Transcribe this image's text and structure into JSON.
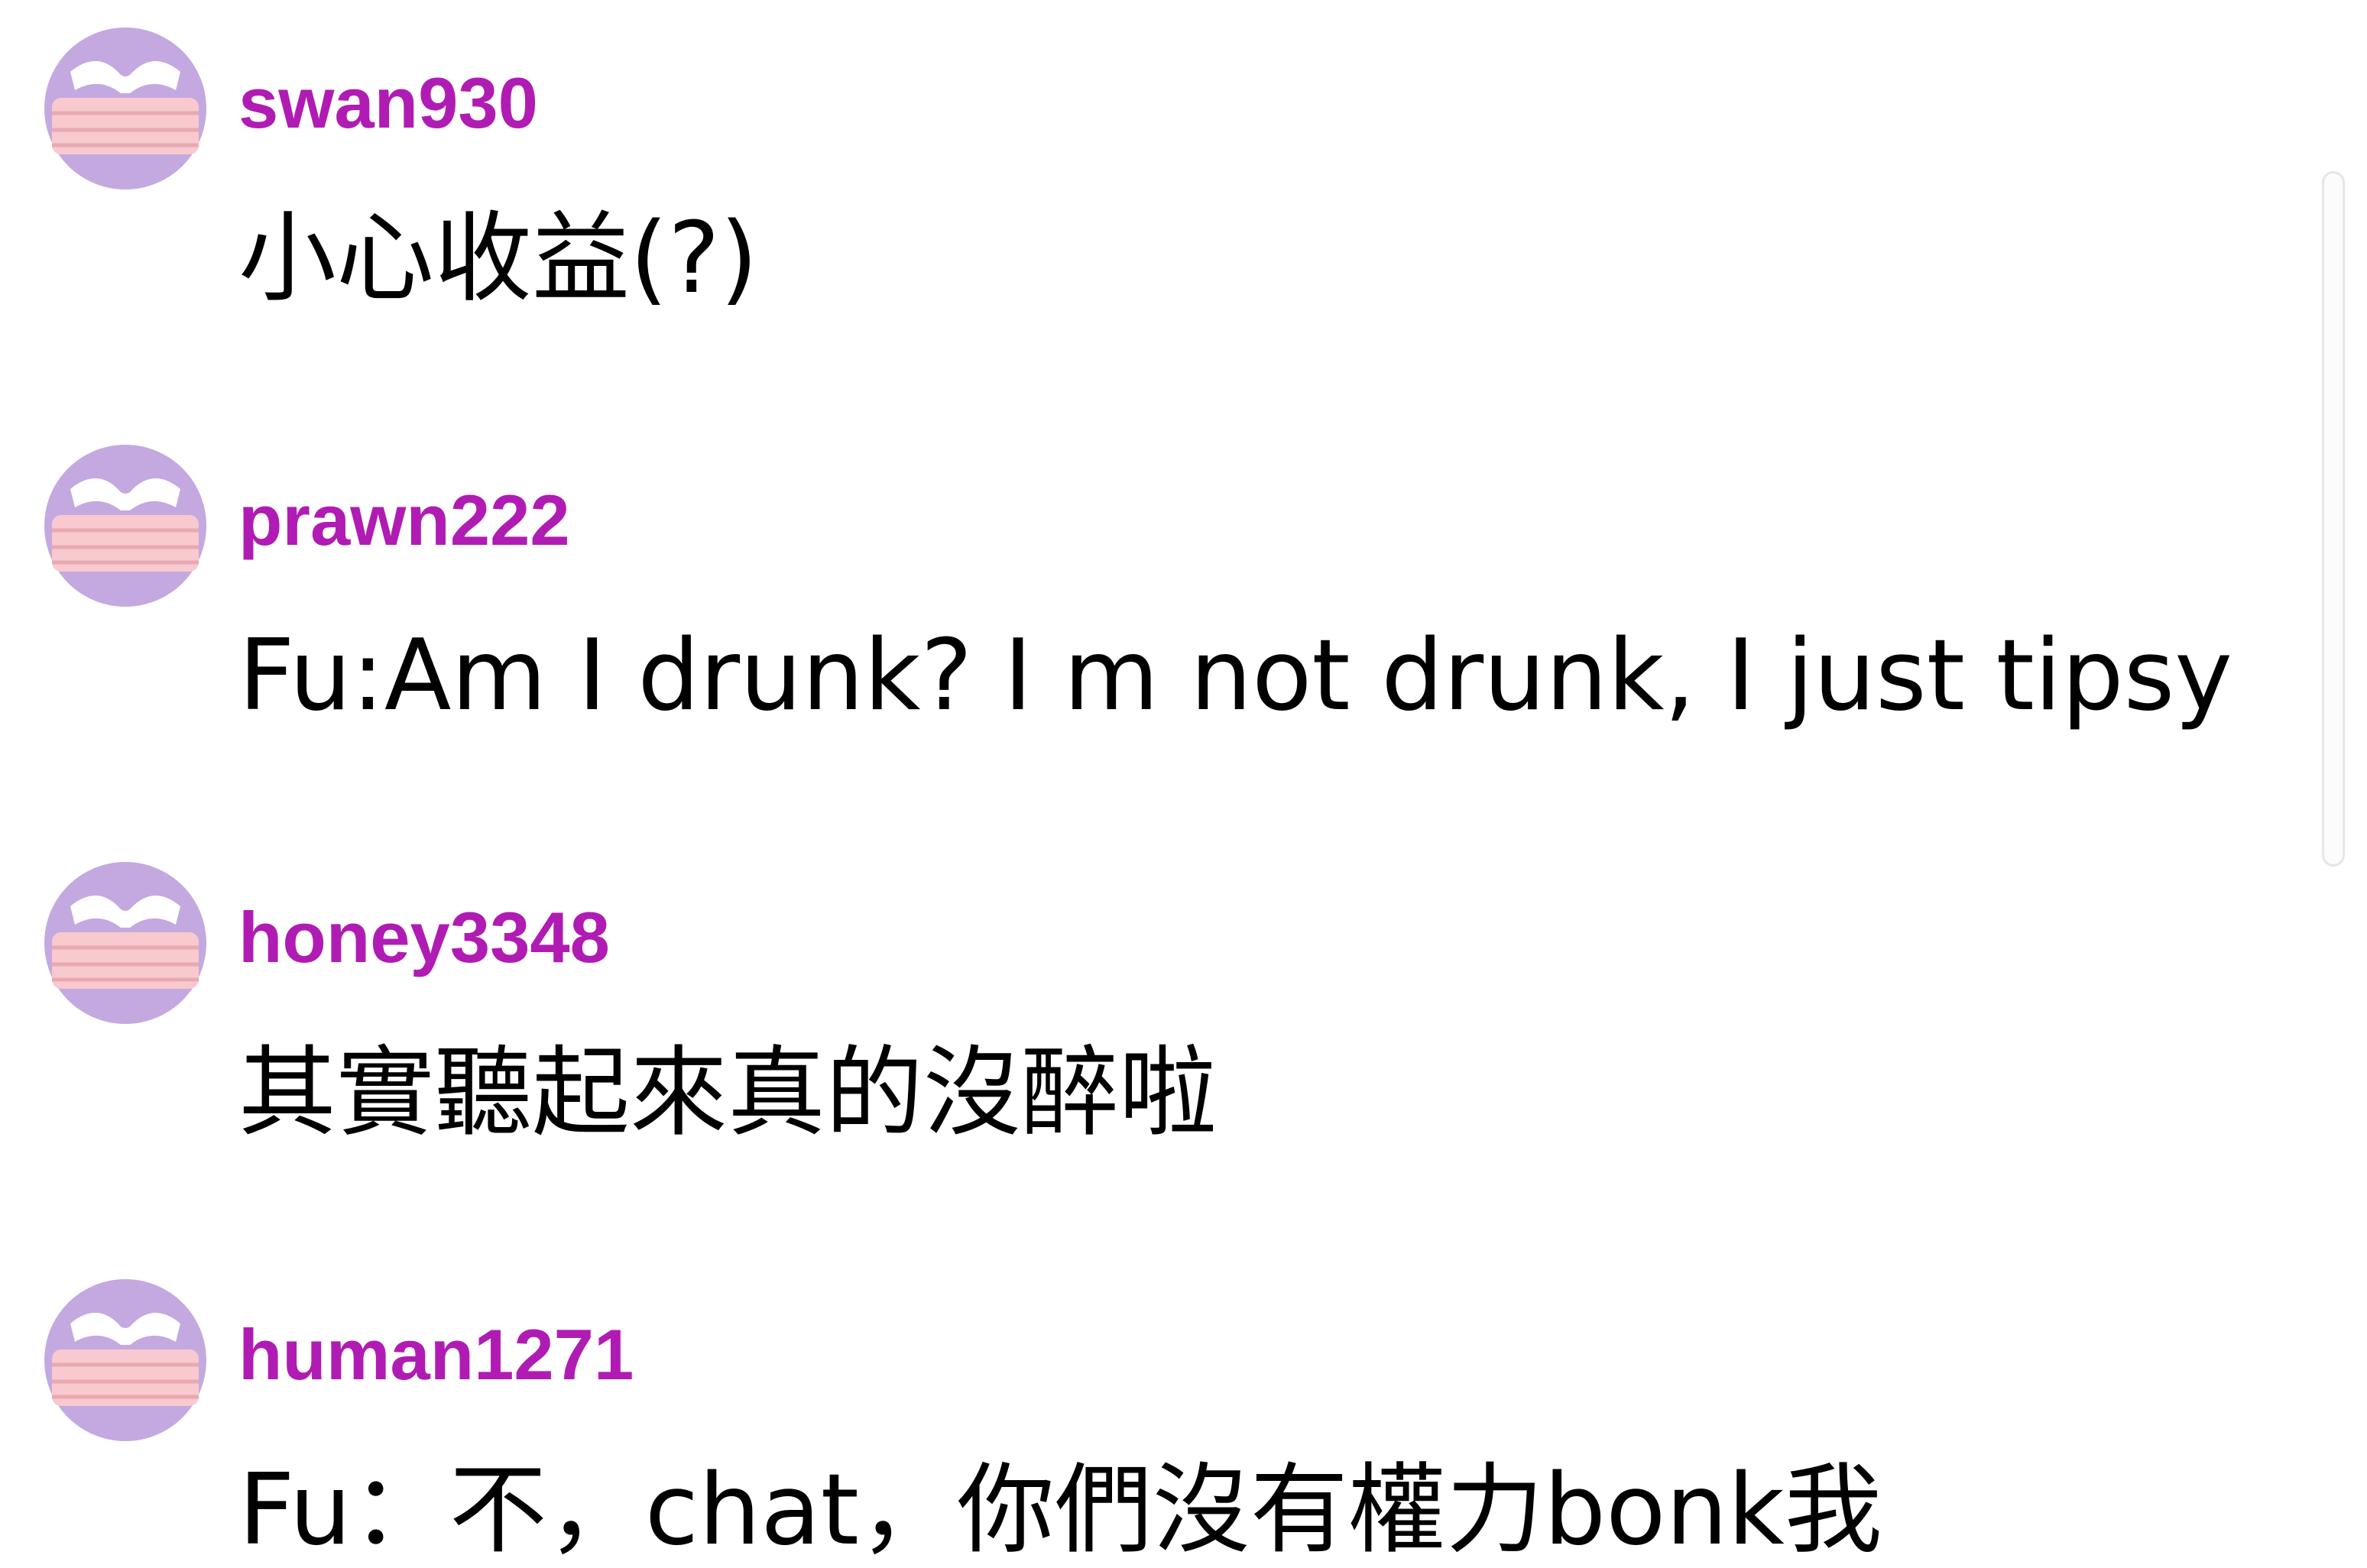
{
  "colors": {
    "username": "#b01cb3",
    "message": "#000000",
    "avatar_background": "#c4a9e0",
    "avatar_mask": "#f8c9ce",
    "avatar_eyes": "#ffffff",
    "scrollbar": "#e6e6e6"
  },
  "messages": [
    {
      "username": "swan930",
      "text": "小心收益(?)",
      "avatar_icon": "masked-avatar-icon"
    },
    {
      "username": "prawn222",
      "text": "Fu:Am I drunk? I m not drunk, I just tipsy",
      "avatar_icon": "masked-avatar-icon"
    },
    {
      "username": "honey3348",
      "text": "其實聽起來真的沒醉啦",
      "avatar_icon": "masked-avatar-icon"
    },
    {
      "username": "human1271",
      "text": "Fu：不，chat，你們沒有權力bonk我",
      "avatar_icon": "masked-avatar-icon"
    }
  ]
}
